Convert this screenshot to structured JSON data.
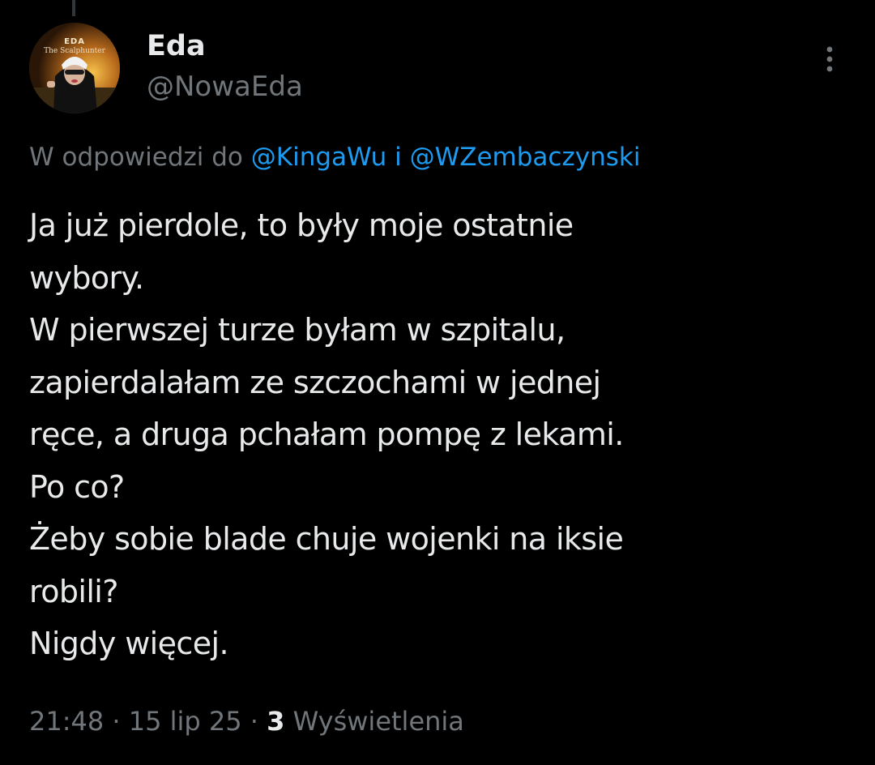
{
  "colors": {
    "background": "#000000",
    "primary_text": "#e7e9ea",
    "secondary_text": "#71767b",
    "link": "#1d9bf0"
  },
  "avatar": {
    "logo_title": "EDA",
    "logo_subtitle": "The Scalphunter"
  },
  "author": {
    "display_name": "Eda",
    "handle": "@NowaEda"
  },
  "reply": {
    "prefix": "W odpowiedzi do",
    "mention_1": "@KingaWu",
    "joiner": "i",
    "mention_2": "@WZembaczynski"
  },
  "tweet": {
    "lines": [
      "Ja już pierdole, to były moje ostatnie",
      "wybory.",
      "W pierwszej turze byłam w szpitalu,",
      "zapierdalałam ze szczochami w jednej",
      "ręce, a druga pchałam pompę z lekami.",
      "Po co?",
      "Żeby sobie blade chuje wojenki na iksie",
      "robili?",
      "Nigdy więcej."
    ]
  },
  "meta": {
    "time": "21:48",
    "separator": "·",
    "date": "15 lip 25",
    "views_count": "3",
    "views_label": "Wyświetlenia"
  },
  "icons": {
    "more": "more-vertical-icon"
  }
}
